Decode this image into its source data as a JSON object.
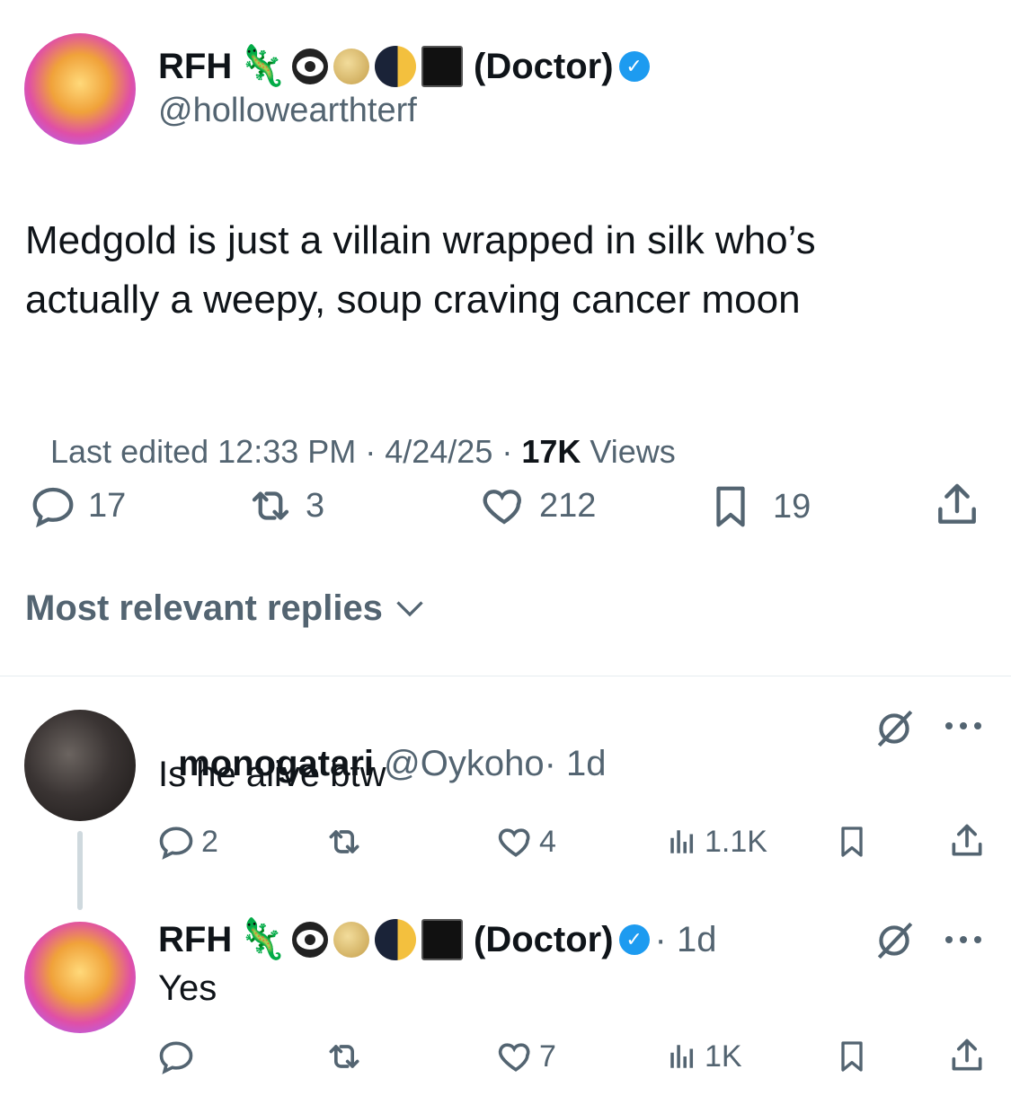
{
  "tweet": {
    "author_name": "RFH",
    "author_suffix": "(Doctor)",
    "author_handle": "@hollowearthterf",
    "text_line1": "Medgold is just a villain wrapped in silk who’s",
    "text_line2": "actually a weepy, soup craving cancer moon",
    "meta_prefix": "Last edited 12:33 PM · 4/24/25 · ",
    "views_count": "17K",
    "views_label": " Views",
    "replies": "17",
    "retweets": "3",
    "likes": "212",
    "bookmarks": "19"
  },
  "replies_header": "Most relevant replies",
  "reply1": {
    "name": "monogatari",
    "handle": "@Oykoho",
    "time": "· 1d",
    "text": "Is he alive btw",
    "replies": "2",
    "likes": "4",
    "views": "1.1K"
  },
  "reply2": {
    "name": "RFH",
    "suffix": "(Doctor)",
    "time": "· 1d",
    "text": "Yes",
    "likes": "7",
    "views": "1K"
  },
  "icons": {
    "verified": "verified-badge",
    "gecko": "🦎"
  },
  "colors": {
    "accent": "#1d9bf0",
    "muted": "#536471"
  }
}
